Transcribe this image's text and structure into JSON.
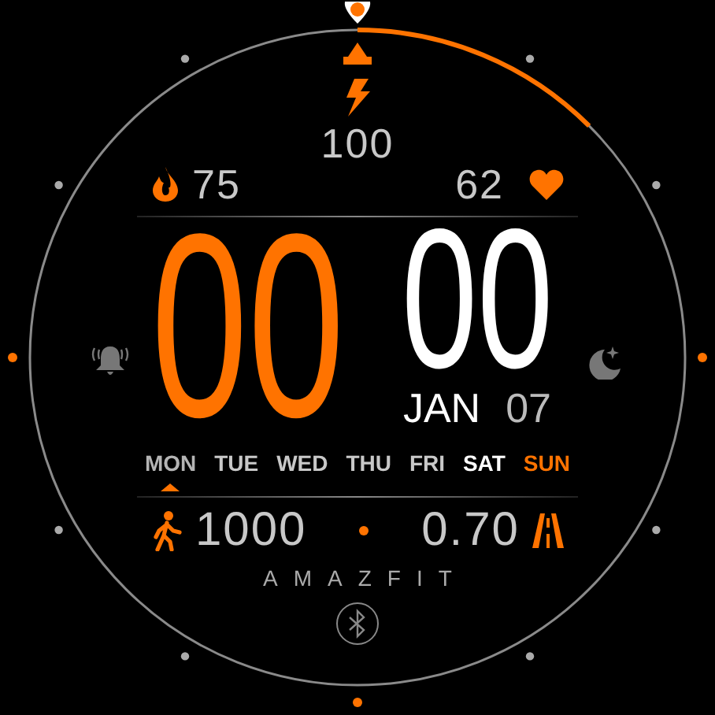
{
  "battery": {
    "value": "100"
  },
  "calories": {
    "value": "75"
  },
  "heart_rate": {
    "value": "62"
  },
  "time": {
    "hours": "00",
    "minutes": "00"
  },
  "date": {
    "month": "JAN",
    "day": "07"
  },
  "weekdays": [
    {
      "label": "MON",
      "selected": true,
      "color": "#b4b4b4"
    },
    {
      "label": "TUE",
      "selected": false,
      "color": "#c8c8c8"
    },
    {
      "label": "WED",
      "selected": false,
      "color": "#c8c8c8"
    },
    {
      "label": "THU",
      "selected": false,
      "color": "#c8c8c8"
    },
    {
      "label": "FRI",
      "selected": false,
      "color": "#c8c8c8"
    },
    {
      "label": "SAT",
      "selected": false,
      "color": "#ffffff"
    },
    {
      "label": "SUN",
      "selected": false,
      "color": "#ff7300"
    }
  ],
  "steps": {
    "value": "1000"
  },
  "distance": {
    "value": "0.70"
  },
  "brand": "AMAZFIT"
}
